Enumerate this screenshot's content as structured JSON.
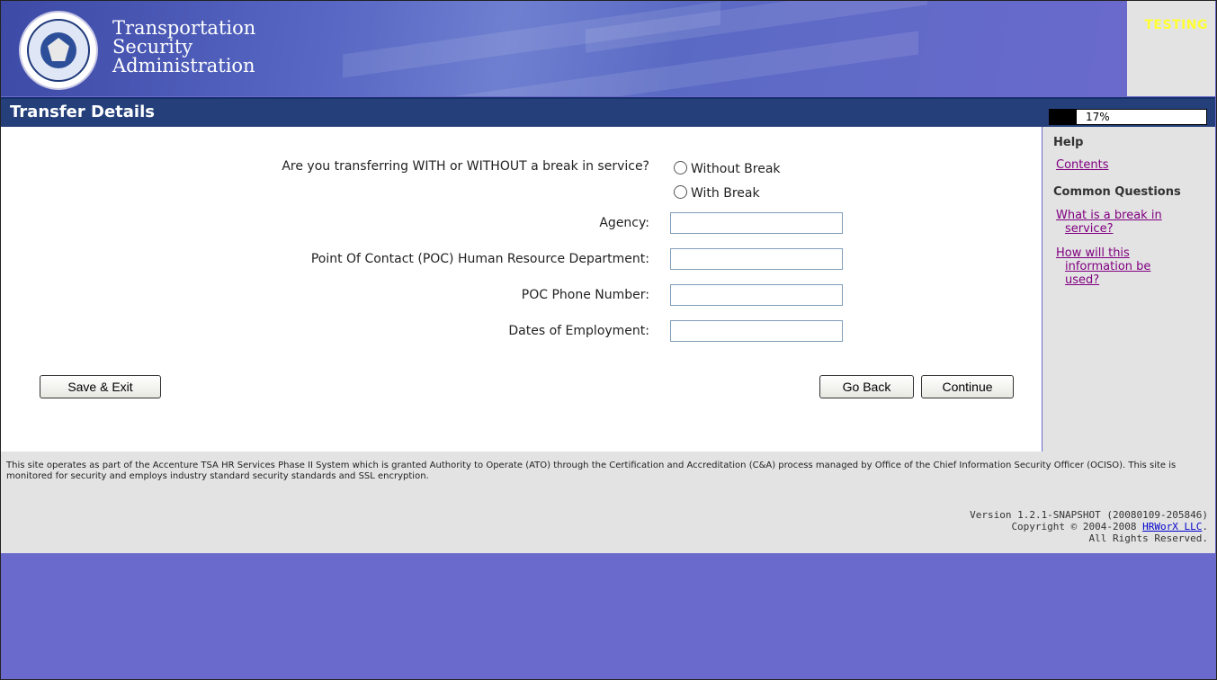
{
  "header": {
    "logo_lines": [
      "Transportation",
      "Security",
      "Administration"
    ],
    "environment_badge": "TESTING"
  },
  "titlebar": {
    "title": "Transfer Details",
    "progress_label": "17%",
    "progress_value": 0.17
  },
  "form": {
    "break_question": "Are you transferring WITH or WITHOUT a break in service?",
    "break_options": [
      "Without Break",
      "With Break"
    ],
    "agency_label": "Agency:",
    "agency_value": "",
    "poc_label": "Point Of Contact (POC) Human Resource Department:",
    "poc_value": "",
    "poc_phone_label": "POC Phone Number:",
    "poc_phone_value": "",
    "employment_dates_label": "Dates of Employment:",
    "employment_dates_value": "",
    "save_exit_label": "Save & Exit",
    "go_back_label": "Go Back",
    "continue_label": "Continue"
  },
  "sidebar": {
    "help_heading": "Help",
    "contents_link": "Contents",
    "common_questions_heading": "Common Questions",
    "question_links": [
      {
        "line1": "What is a break in",
        "line2": "service?"
      },
      {
        "line1": "How will this",
        "line2": "information be",
        "line3": "used?"
      }
    ]
  },
  "footer": {
    "disclaimer": "This site operates as part of the Accenture TSA HR Services Phase II System which is granted Authority to Operate (ATO) through the Certification and Accreditation (C&A) process managed by Office of the Chief Information Security Officer (OCISO). This site is monitored for security and employs industry standard security standards and SSL encryption.",
    "version": "Version 1.2.1-SNAPSHOT (20080109-205846)",
    "copyright_prefix": "Copyright © 2004-2008",
    "company_link": "HRWorX LLC",
    "copyright_suffix": ".",
    "rights": "All Rights Reserved."
  }
}
